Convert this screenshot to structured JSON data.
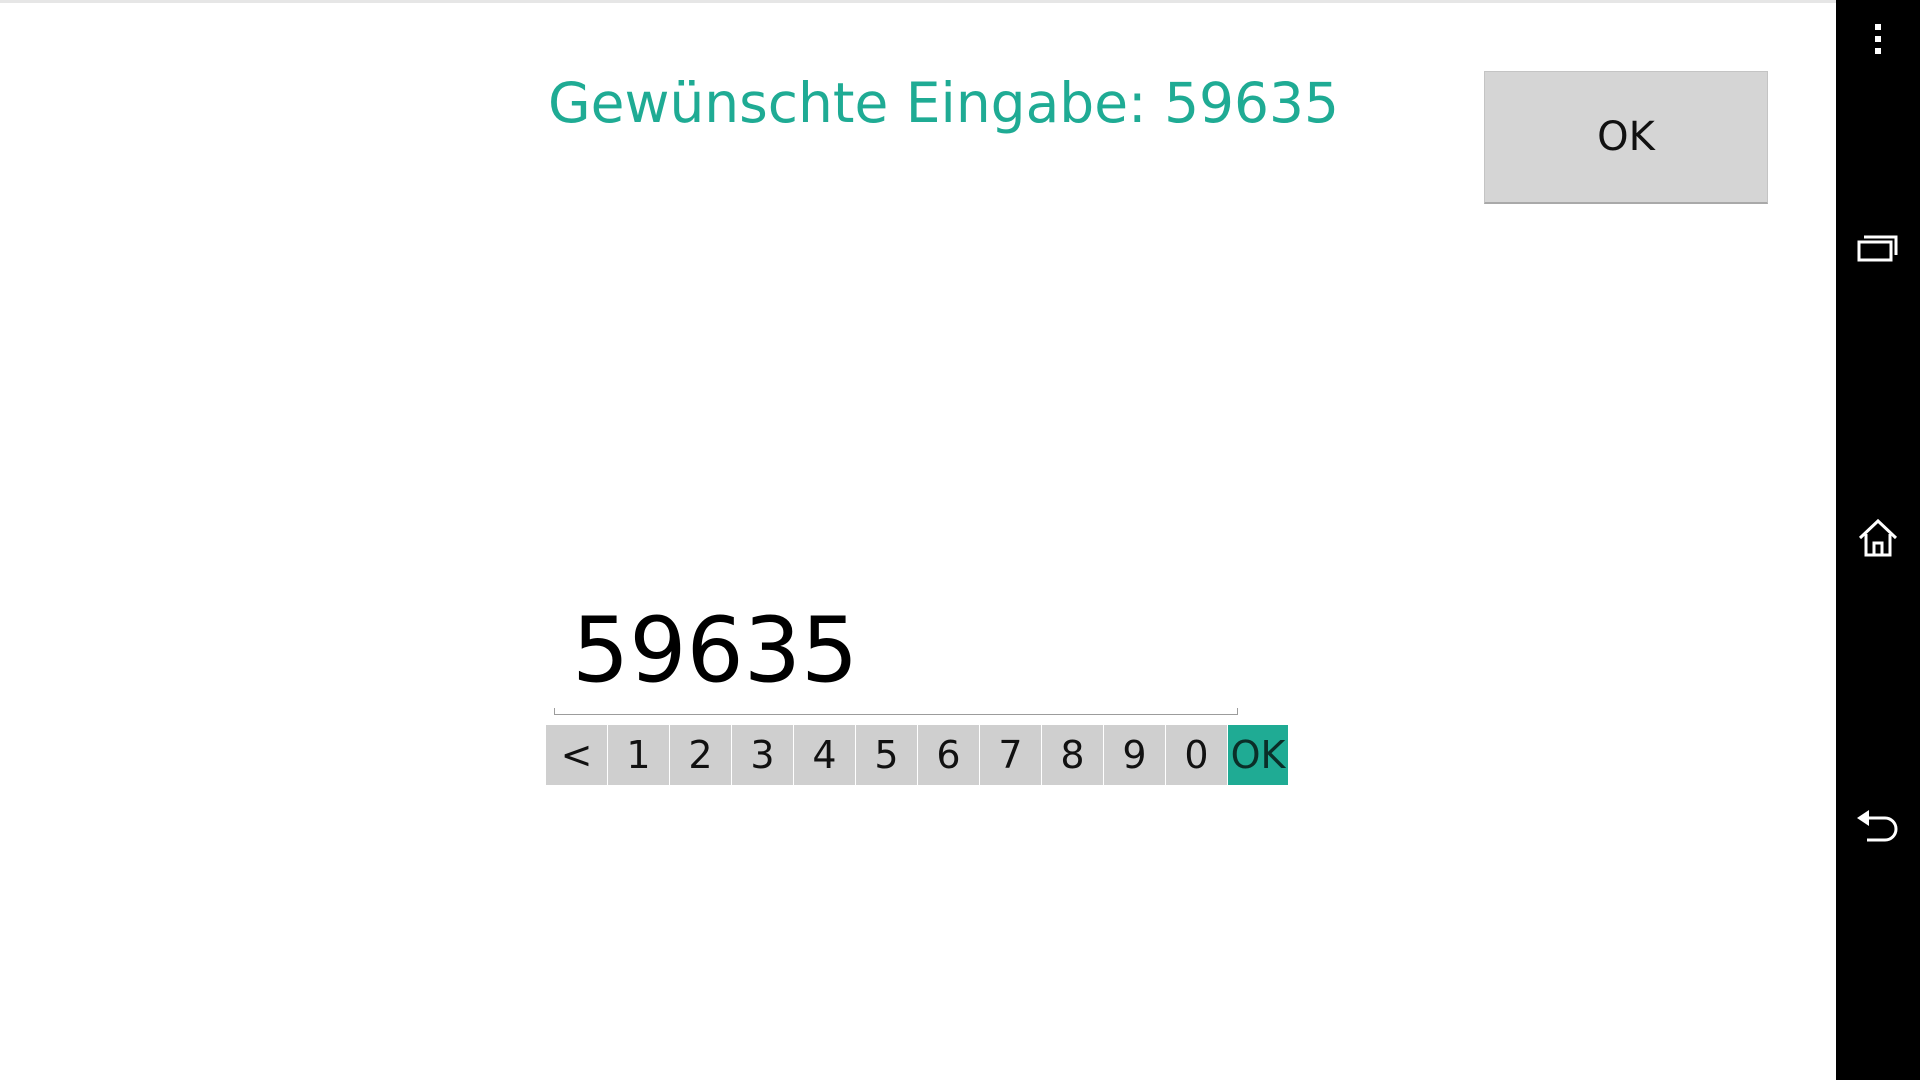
{
  "app": {
    "title": "Gewünschte Eingabe: 59635",
    "ok_button_label": "OK"
  },
  "input": {
    "value": "59635"
  },
  "keypad": {
    "keys": [
      "<",
      "1",
      "2",
      "3",
      "4",
      "5",
      "6",
      "7",
      "8",
      "9",
      "0",
      "OK"
    ]
  },
  "navbar": {
    "icons": [
      "overflow-menu-icon",
      "recent-apps-icon",
      "home-icon",
      "back-icon"
    ]
  },
  "colors": {
    "accent": "#1fab94",
    "key_background": "#cfcfcf",
    "navbar_background": "#000000"
  }
}
